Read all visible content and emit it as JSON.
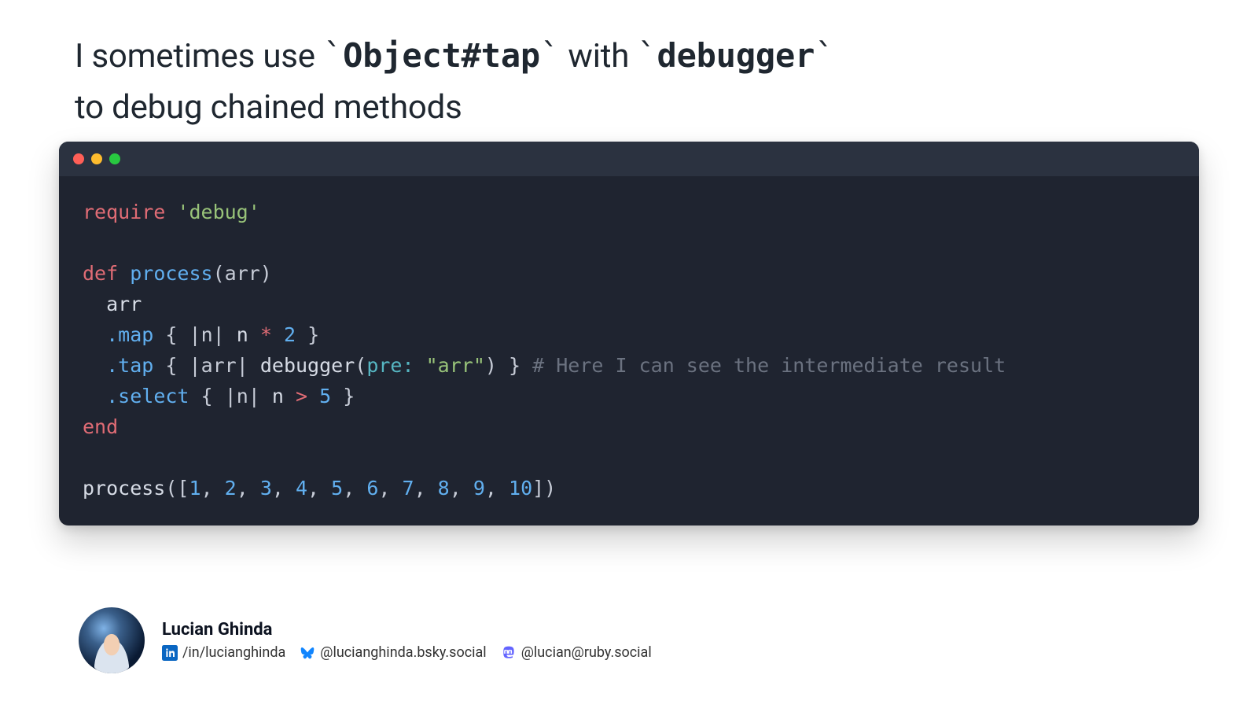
{
  "heading": {
    "prefix": "I sometimes use ",
    "tick": "`",
    "code1": "Object#tap",
    "mid": " with ",
    "code2": "debugger",
    "line2": "to debug chained methods"
  },
  "code": {
    "require_kw": "require",
    "require_str": "'debug'",
    "def_kw": "def",
    "fn_name": "process",
    "param": "arr",
    "arr_line": "arr",
    "map": ".map",
    "block_open": "{ ",
    "pipe_n": "|n|",
    "n_var": "n",
    "star": "*",
    "two": "2",
    "block_close": " }",
    "tap": ".tap",
    "pipe_arr": "|arr|",
    "debugger": "debugger",
    "pre_key": "pre:",
    "pre_val": "\"arr\"",
    "comment": "# Here I can see the intermediate result",
    "select": ".select",
    "gt": ">",
    "five": "5",
    "end_kw": "end",
    "call_fn": "process",
    "arr_open": "([",
    "nums": [
      "1",
      "2",
      "3",
      "4",
      "5",
      "6",
      "7",
      "8",
      "9",
      "10"
    ],
    "arr_close": "])"
  },
  "author": {
    "name": "Lucian Ghinda",
    "linkedin": "/in/lucianghinda",
    "bluesky": "@lucianghinda.bsky.social",
    "mastodon": "@lucian@ruby.social"
  },
  "colors": {
    "bg_window": "#1f2430",
    "bg_titlebar": "#2b3240",
    "kw": "#e06c75",
    "fn": "#61afef",
    "str": "#98c379",
    "cmt": "#6b7280"
  }
}
